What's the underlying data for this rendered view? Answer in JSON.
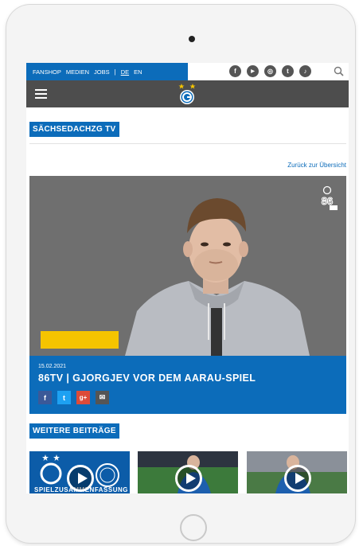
{
  "topnav": {
    "items": [
      "FANSHOP",
      "MEDIEN",
      "JOBS"
    ],
    "separator": "|",
    "languages": [
      "DE",
      "EN"
    ],
    "active_language": "DE"
  },
  "social": {
    "icons": [
      "facebook-icon",
      "youtube-icon",
      "instagram-icon",
      "twitter-icon",
      "tiktok-icon",
      "search-icon"
    ],
    "glyphs": [
      "f",
      "▶",
      "◎",
      "t",
      "♪"
    ]
  },
  "header": {
    "menu_icon": "hamburger-menu-icon",
    "logo": "club-crest-logo"
  },
  "section": {
    "title": "SÄCHSEDACHZG TV",
    "back_link": "Zurück zur Übersicht"
  },
  "video": {
    "date": "15.02.2021",
    "title": "86TV | GJORGJEV VOR DEM AARAU-SPIEL",
    "watermark": "86TV logo"
  },
  "share": [
    {
      "label": "f",
      "icon": "facebook-share-icon",
      "color": "#3b5998"
    },
    {
      "label": "t",
      "icon": "twitter-share-icon",
      "color": "#1da1f2"
    },
    {
      "label": "g+",
      "icon": "googleplus-share-icon",
      "color": "#dd4b39"
    },
    {
      "label": "✉",
      "icon": "email-share-icon",
      "color": "#555555"
    }
  ],
  "more": {
    "title": "WEITERE BEITRÄGE",
    "thumbnail_caption": "SPIELZUSAMMENFASSUNG"
  },
  "colors": {
    "brand_blue": "#0c6cba",
    "header_gray": "#4d4d4d",
    "accent_yellow": "#f5c400"
  }
}
